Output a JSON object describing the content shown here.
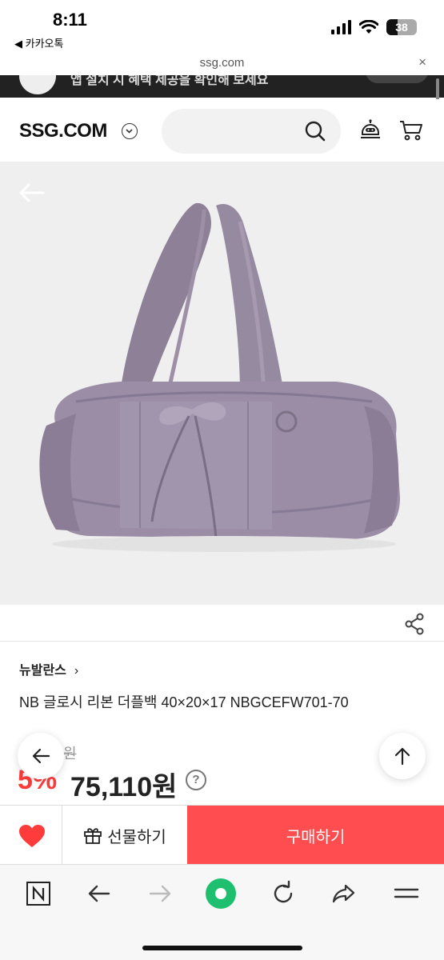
{
  "status": {
    "time": "8:11",
    "back_app": "◀ 카카오톡",
    "battery": "38"
  },
  "browser": {
    "url": "ssg.com",
    "close": "×"
  },
  "banner": {
    "text": "앱 설치 시 혜택 제공을 확인해 보세요"
  },
  "header": {
    "logo": "SSG.COM",
    "search_placeholder": ""
  },
  "product": {
    "brand": "뉴발란스",
    "brand_arrow": "›",
    "name": "NB 글로시 리본 더플백 40×20×17 NBGCEFW701-70",
    "original_price": "79,060원",
    "discount": "5%",
    "price": "75,110원",
    "price_help": "?"
  },
  "actions": {
    "gift_label": "선물하기",
    "buy_label": "구매하기"
  },
  "colors": {
    "accent": "#ff4d50",
    "discount": "#ff3b3b",
    "nav_green": "#1ec070",
    "wish": "#ff3b3b"
  }
}
